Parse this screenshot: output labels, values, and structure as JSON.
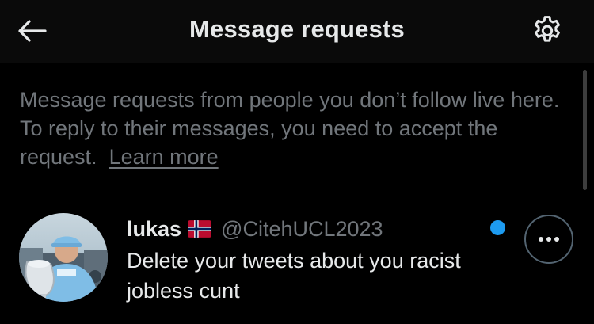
{
  "header": {
    "title": "Message requests",
    "back_icon": "arrow-left-icon",
    "settings_icon": "gear-icon"
  },
  "info": {
    "text": "Message requests from people you don’t follow live here. To reply to their messages, you need to accept the request.",
    "link": "Learn more"
  },
  "requests": [
    {
      "name": "lukas",
      "flag": "norway-flag-icon",
      "handle": "@CitehUCL2023",
      "preview": "Delete your tweets about you racist jobless cunt",
      "unread": true
    }
  ],
  "colors": {
    "background": "#000000",
    "header_background": "#0a0a0a",
    "primary_text": "#e7e9ea",
    "secondary_text": "#71767b",
    "accent": "#1d9bf0",
    "border": "#536471"
  }
}
